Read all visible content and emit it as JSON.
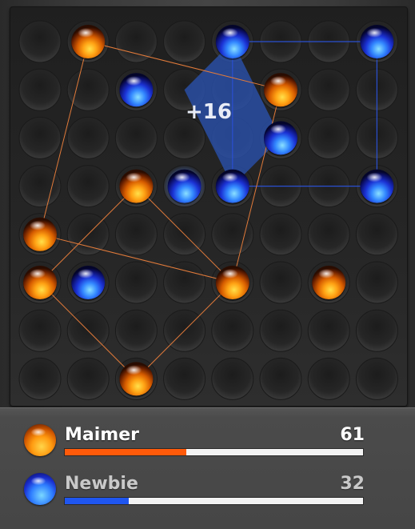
{
  "board": {
    "rows": 8,
    "cols": 8,
    "pieces": [
      {
        "row": 0,
        "col": 1,
        "color": "orange"
      },
      {
        "row": 0,
        "col": 4,
        "color": "blue"
      },
      {
        "row": 0,
        "col": 7,
        "color": "blue"
      },
      {
        "row": 1,
        "col": 2,
        "color": "blue"
      },
      {
        "row": 1,
        "col": 5,
        "color": "orange"
      },
      {
        "row": 2,
        "col": 5,
        "color": "blue"
      },
      {
        "row": 3,
        "col": 2,
        "color": "orange"
      },
      {
        "row": 3,
        "col": 3,
        "color": "blue",
        "highlighted": true
      },
      {
        "row": 3,
        "col": 4,
        "color": "blue"
      },
      {
        "row": 3,
        "col": 7,
        "color": "blue"
      },
      {
        "row": 4,
        "col": 0,
        "color": "orange"
      },
      {
        "row": 5,
        "col": 0,
        "color": "orange"
      },
      {
        "row": 5,
        "col": 1,
        "color": "blue"
      },
      {
        "row": 5,
        "col": 4,
        "color": "orange"
      },
      {
        "row": 5,
        "col": 6,
        "color": "orange"
      },
      {
        "row": 7,
        "col": 2,
        "color": "orange"
      }
    ],
    "orange_squares": [
      [
        [
          0,
          1
        ],
        [
          1,
          5
        ],
        [
          5,
          4
        ],
        [
          4,
          0
        ]
      ],
      [
        [
          3,
          2
        ],
        [
          5,
          4
        ],
        [
          7,
          2
        ],
        [
          5,
          0
        ]
      ]
    ],
    "blue_squares": [
      [
        [
          0,
          4
        ],
        [
          0,
          7
        ],
        [
          3,
          7
        ],
        [
          3,
          4
        ]
      ]
    ],
    "captured_square": [
      [
        0,
        4
      ],
      [
        2,
        5
      ],
      [
        3,
        4
      ],
      [
        1,
        3
      ]
    ],
    "score_popup": "+16",
    "colors": {
      "orange_line": "#e07a3a",
      "blue_line": "#2a4fd0",
      "captured_fill": "#2a4fa8"
    }
  },
  "players": [
    {
      "name": "Maimer",
      "score": "61",
      "score_value": 61,
      "max_score": 150,
      "color": "orange",
      "bar_color": "#ff5a0a"
    },
    {
      "name": "Newbie",
      "score": "32",
      "score_value": 32,
      "max_score": 150,
      "color": "blue",
      "bar_color": "#1f56f0"
    }
  ]
}
